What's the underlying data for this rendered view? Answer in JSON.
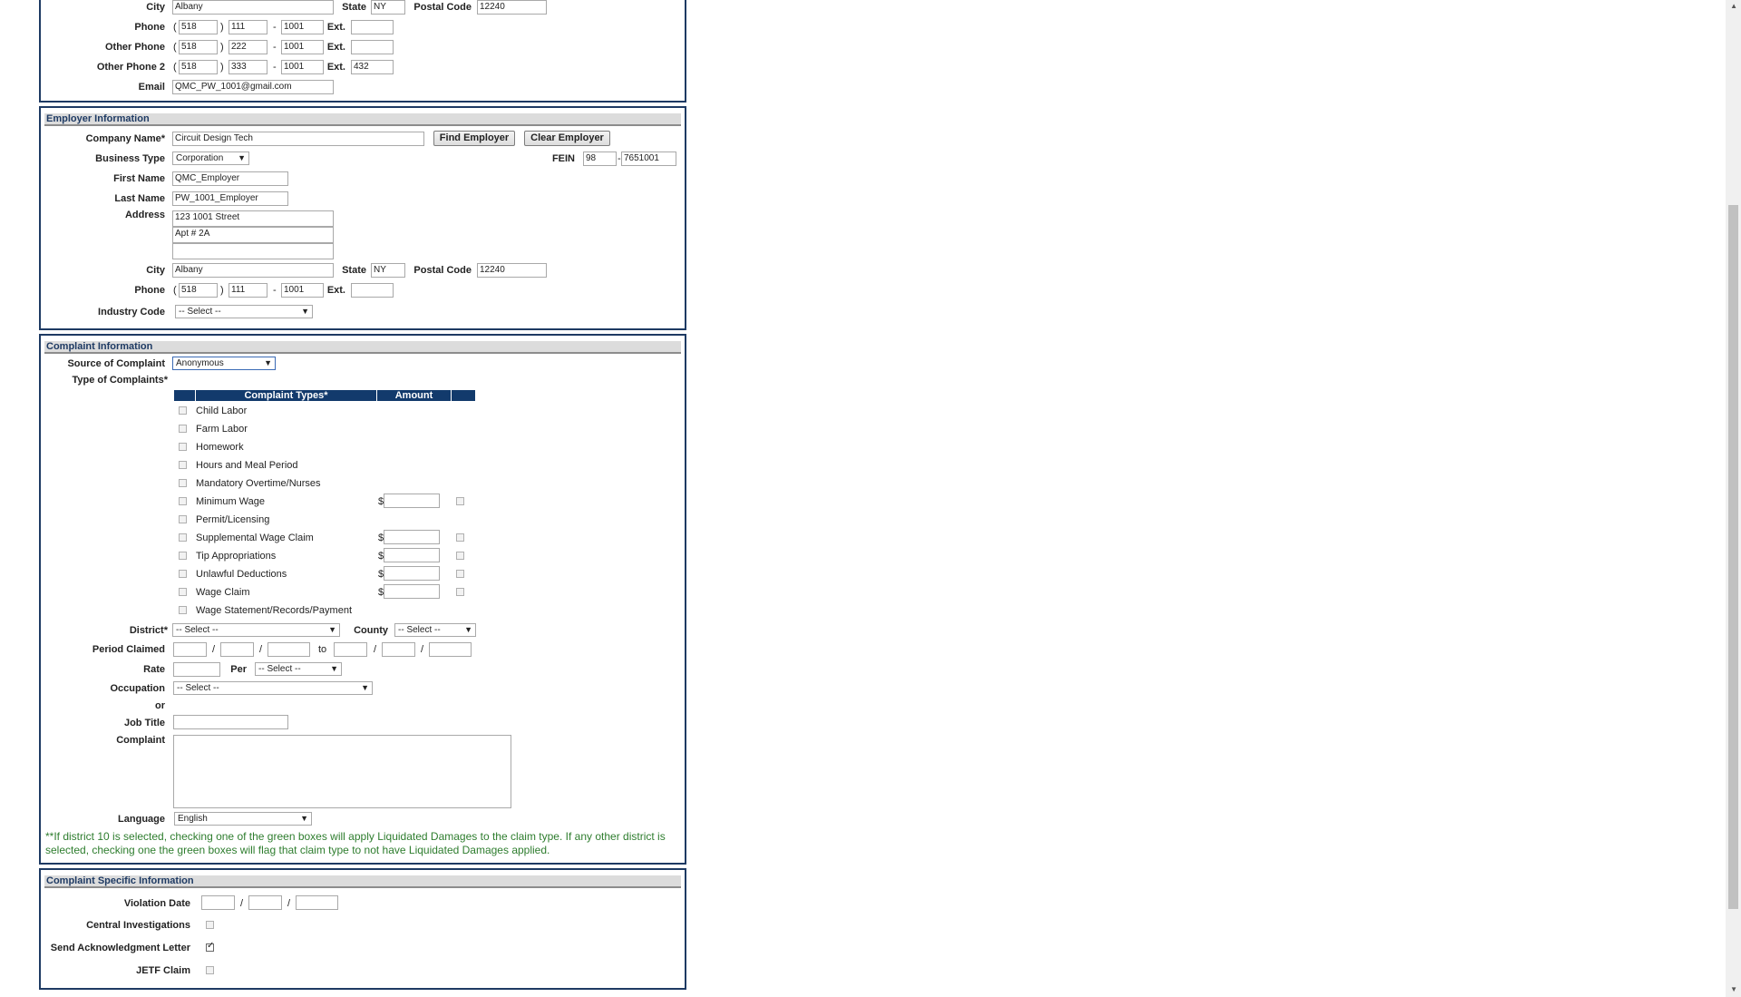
{
  "contact": {
    "city_label": "City",
    "city": "Albany",
    "state_label": "State",
    "state": "NY",
    "postal_label": "Postal Code",
    "postal": "12240",
    "phone_label": "Phone",
    "phone": [
      "518",
      "111",
      "1001",
      ""
    ],
    "other_phone_label": "Other Phone",
    "other_phone": [
      "518",
      "222",
      "1001",
      ""
    ],
    "other_phone2_label": "Other Phone 2",
    "other_phone2": [
      "518",
      "333",
      "1001",
      "432"
    ],
    "ext_label": "Ext.",
    "email_label": "Email",
    "email": "QMC_PW_1001@gmail.com",
    "paren_open": "(",
    "paren_close": ")",
    "dash": "-"
  },
  "employer": {
    "header": "Employer Information",
    "company_label": "Company Name*",
    "company": "Circuit Design Tech",
    "find_button": "Find Employer",
    "clear_button": "Clear Employer",
    "business_type_label": "Business Type",
    "business_type": "Corporation",
    "fein_label": "FEIN",
    "fein": [
      "98",
      "7651001"
    ],
    "first_name_label": "First Name",
    "first_name": "QMC_Employer",
    "last_name_label": "Last Name",
    "last_name": "PW_1001_Employer",
    "address_label": "Address",
    "address": [
      "123 1001 Street",
      "Apt # 2A",
      ""
    ],
    "city_label": "City",
    "city": "Albany",
    "state_label": "State",
    "state": "NY",
    "postal_label": "Postal Code",
    "postal": "12240",
    "phone_label": "Phone",
    "phone": [
      "518",
      "111",
      "1001",
      ""
    ],
    "ext_label": "Ext.",
    "industry_label": "Industry Code",
    "industry": "-- Select --"
  },
  "complaint": {
    "header": "Complaint Information",
    "source_label": "Source of Complaint",
    "source": "Anonymous",
    "types_label": "Type of Complaints*",
    "table_header_types": "Complaint Types*",
    "table_header_amount": "Amount",
    "dollar": "$",
    "types": [
      {
        "label": "Child Labor",
        "has_amount": false
      },
      {
        "label": "Farm Labor",
        "has_amount": false
      },
      {
        "label": "Homework",
        "has_amount": false
      },
      {
        "label": "Hours and Meal Period",
        "has_amount": false
      },
      {
        "label": "Mandatory Overtime/Nurses",
        "has_amount": false
      },
      {
        "label": "Minimum Wage",
        "has_amount": true
      },
      {
        "label": "Permit/Licensing",
        "has_amount": false
      },
      {
        "label": "Supplemental Wage Claim",
        "has_amount": true
      },
      {
        "label": "Tip Appropriations",
        "has_amount": true
      },
      {
        "label": "Unlawful Deductions",
        "has_amount": true
      },
      {
        "label": "Wage Claim",
        "has_amount": true
      },
      {
        "label": "Wage Statement/Records/Payment",
        "has_amount": false
      }
    ],
    "district_label": "District*",
    "district": "-- Select --",
    "county_label": "County",
    "county": "-- Select --",
    "period_label": "Period Claimed",
    "slash": "/",
    "to": "to",
    "rate_label": "Rate",
    "per_label": "Per",
    "per": "-- Select --",
    "occupation_label": "Occupation",
    "occupation": "-- Select --",
    "or_label": "or",
    "job_title_label": "Job Title",
    "complaint_label": "Complaint",
    "language_label": "Language",
    "language": "English",
    "note": "**If district 10 is selected, checking one of the green boxes will apply Liquidated Damages to the claim type. If any other district is selected, checking one the green boxes will flag that claim type to not have Liquidated Damages applied."
  },
  "specific": {
    "header": "Complaint Specific Information",
    "violation_label": "Violation Date",
    "central_label": "Central Investigations",
    "ack_label": "Send Acknowledgment Letter",
    "jetf_label": "JETF Claim"
  },
  "icons": {
    "dropdown": "▼",
    "scroll_up": "▲",
    "scroll_down": "▼"
  }
}
